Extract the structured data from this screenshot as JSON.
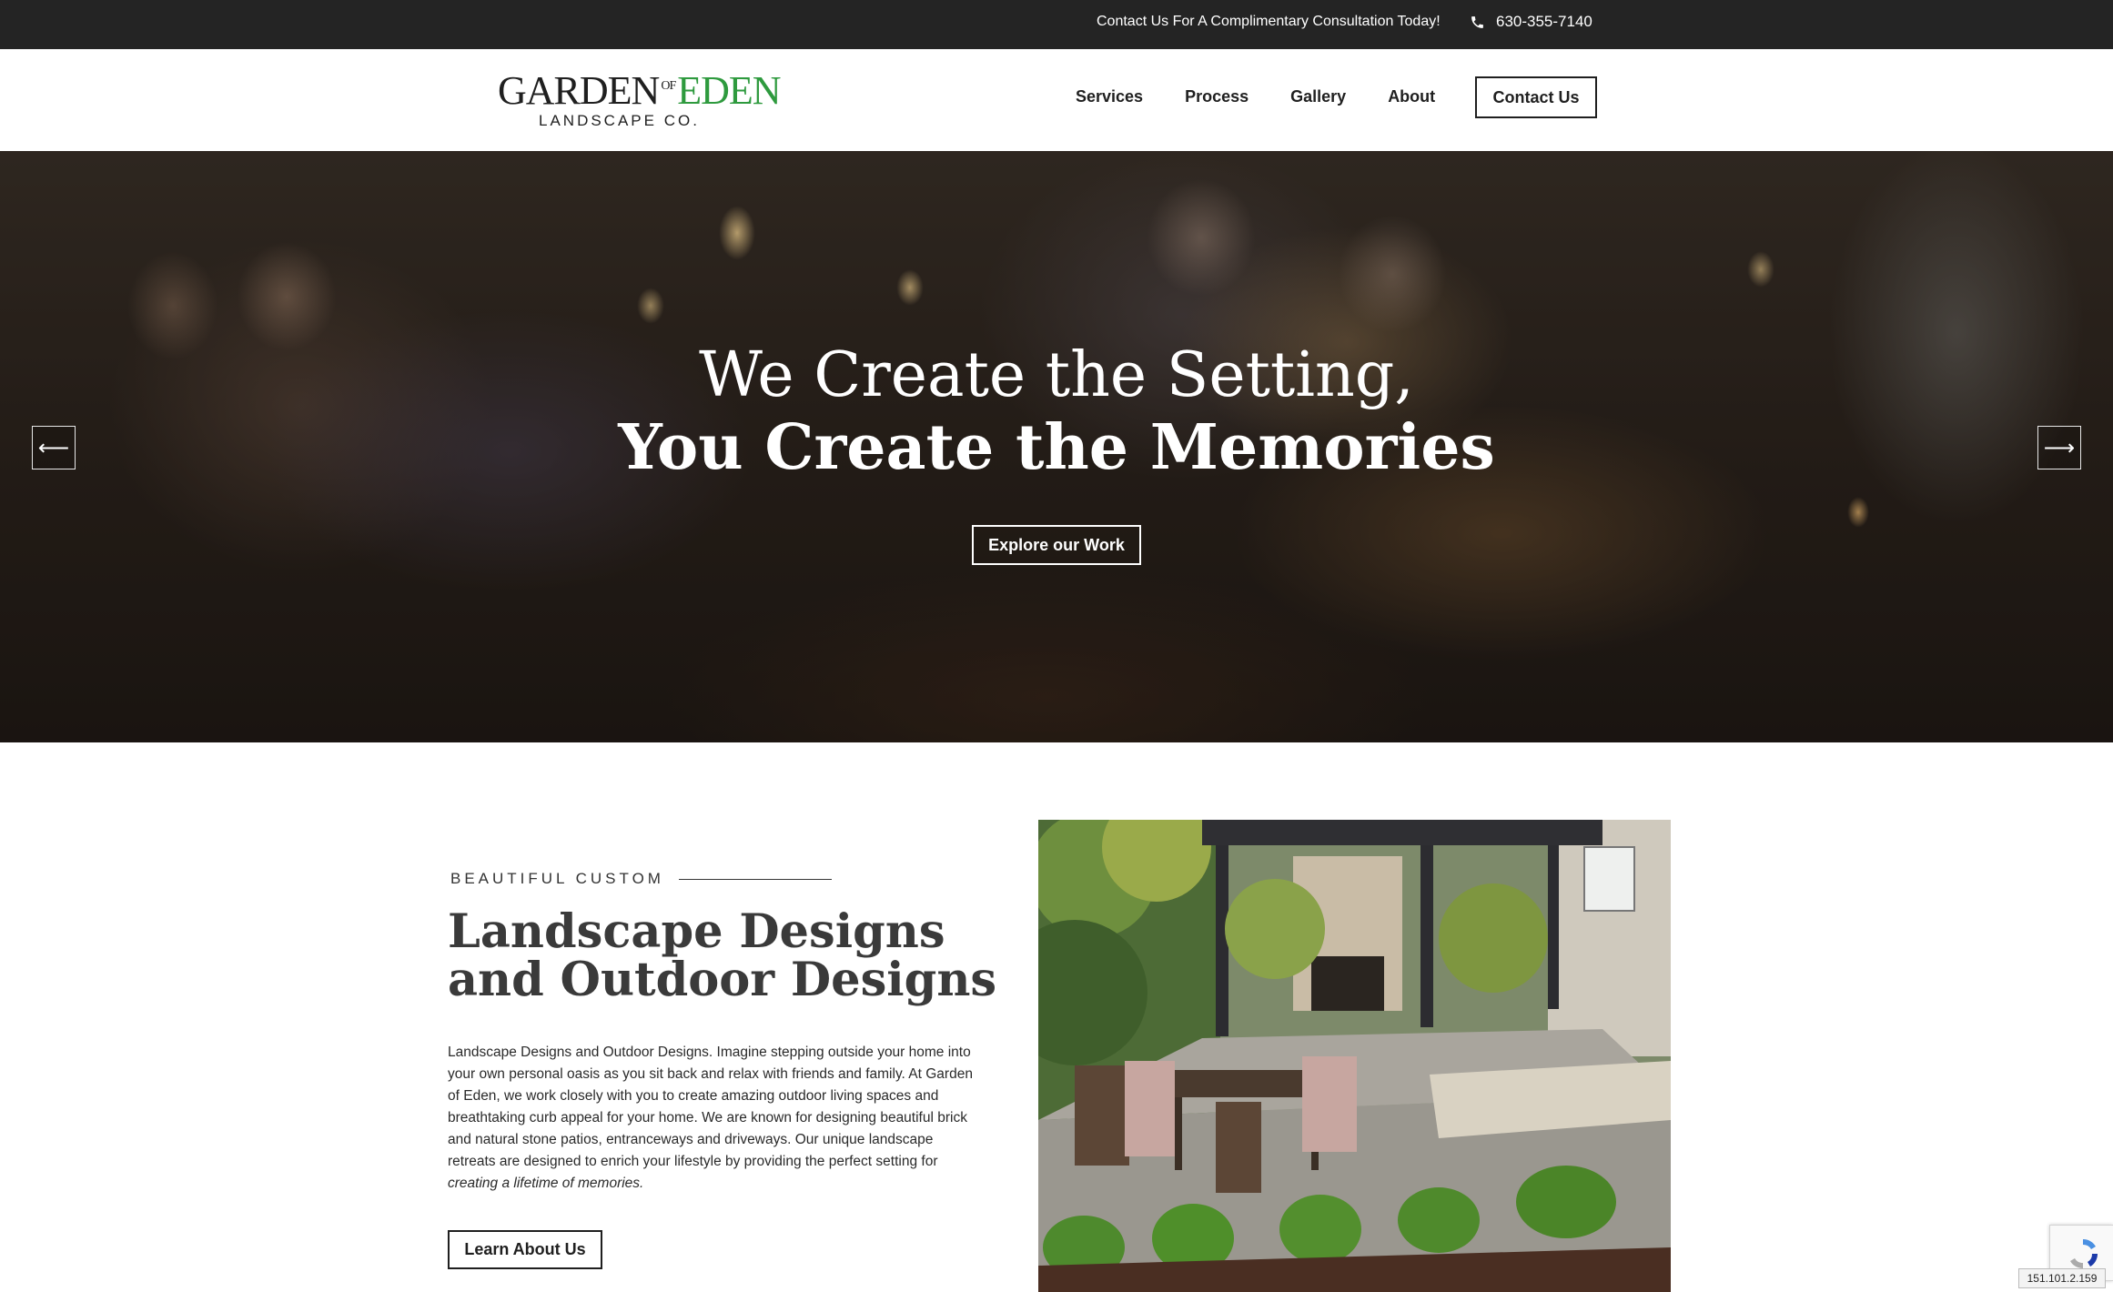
{
  "topbar": {
    "promo_text": "Contact Us For A Complimentary Consultation Today!",
    "phone_icon": "phone-icon",
    "phone_number": "630-355-7140"
  },
  "header": {
    "logo": {
      "brand_left": "GARDEN",
      "brand_of": "OF",
      "brand_right": "EDEN",
      "subtitle": "LANDSCAPE CO."
    },
    "nav": [
      {
        "label": "Services"
      },
      {
        "label": "Process"
      },
      {
        "label": "Gallery"
      },
      {
        "label": "About"
      }
    ],
    "contact_label": "Contact Us"
  },
  "hero": {
    "title_line1": "We Create the Setting,",
    "title_line2": "You Create the Memories",
    "cta_label": "Explore our Work",
    "prev_icon": "arrow-left-icon",
    "next_icon": "arrow-right-icon",
    "prev_glyph": "⟵",
    "next_glyph": "⟶"
  },
  "about": {
    "eyebrow": "BEAUTIFUL CUSTOM",
    "title": "Landscape Designs and Outdoor Designs",
    "body": "Landscape Designs and Outdoor Designs. Imagine stepping outside your home into your own personal oasis as you sit back and relax with friends and family. At Garden of Eden, we work closely with you to create amazing outdoor living spaces and breathtaking curb appeal for your home. We are known for designing beautiful brick and natural stone patios, entranceways and driveways. Our unique landscape retreats are designed to enrich your lifestyle by providing the perfect setting for ",
    "body_emphasis": "creating a lifetime of memories.",
    "cta_label": "Learn About Us"
  },
  "badges": {
    "ip_address": "151.101.2.159"
  },
  "colors": {
    "topbar_bg": "#242424",
    "brand_green": "#2e9a3e",
    "text_dark": "#1f1f1f",
    "heading": "#3a3a3a"
  }
}
